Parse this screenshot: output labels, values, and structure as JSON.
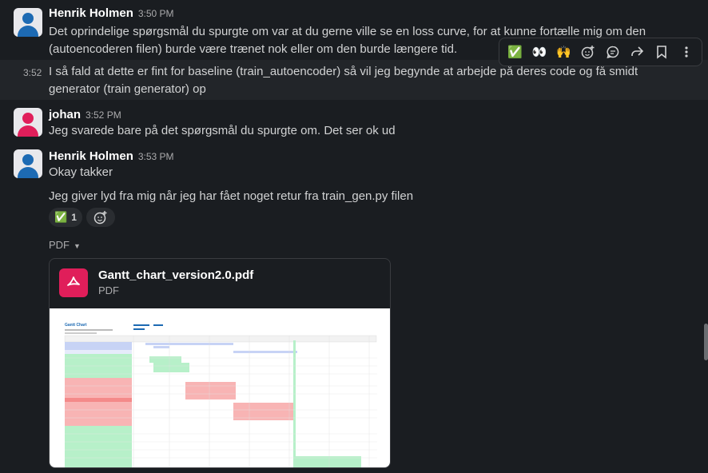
{
  "messages": [
    {
      "author": "Henrik Holmen",
      "time": "3:50 PM",
      "text": "Det oprindelige spørgsmål du spurgte om var at du gerne ville se en loss curve, for at kunne fortælle mig om den (autoencoderen filen) burde være trænet nok eller om den burde længere tid."
    },
    {
      "side_time": "3:52",
      "text": "I så fald at dette er fint for baseline (train_autoencoder) så vil jeg begynde at arbejde på deres code og få smidt generator (train generator) op"
    },
    {
      "author": "johan",
      "time": "3:52 PM",
      "text": "Jeg svarede bare på det spørgsmål du spurgte om. Det ser ok ud"
    },
    {
      "author": "Henrik Holmen",
      "time": "3:53 PM",
      "text": "Okay takker",
      "text2": "Jeg giver lyd fra mig når jeg har fået noget retur fra train_gen.py filen"
    }
  ],
  "reaction": {
    "emoji": "✅",
    "count": "1"
  },
  "toolbar": {
    "items": [
      "check-reaction",
      "eyes-reaction",
      "raised-hands-reaction",
      "add-reaction",
      "reply-in-thread",
      "share-message",
      "save-message",
      "more-actions"
    ],
    "glyphs": {
      "check": "✅",
      "eyes": "👀",
      "hands": "🙌",
      "add_emoji": "☺",
      "thread": "💬",
      "share": "↪",
      "save": "🔖",
      "more": "⋮"
    }
  },
  "attachment": {
    "section_label": "PDF",
    "file_name": "Gantt_chart_version2.0.pdf",
    "file_type": "PDF",
    "preview_title": "Gantt Chart"
  },
  "colors": {
    "background": "#1a1d21",
    "hover": "#222529",
    "pdf_red": "#e01e5a",
    "link_blue": "#1d9bd1"
  }
}
